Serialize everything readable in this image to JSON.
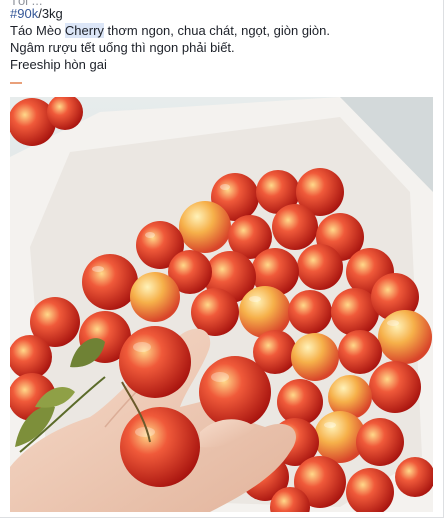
{
  "post": {
    "cut_line": "Tôi ...",
    "hashtag": "#90k",
    "price_suffix": "/3kg",
    "line1_a": "Táo Mèo ",
    "line1_highlight": "Cherry",
    "line1_b": " thơm ngon, chua chát, ngọt, giòn giòn.",
    "line2": "Ngâm rượu tết uống thì ngon phải biết.",
    "line3": "Freeship hòn gai"
  },
  "colors": {
    "hashtag": "#365899",
    "apple_red": "#d62a1e",
    "apple_yellow": "#f2c14e",
    "tray": "#f3f1ee"
  },
  "photo": {
    "icon": "apples-in-box-photo"
  }
}
